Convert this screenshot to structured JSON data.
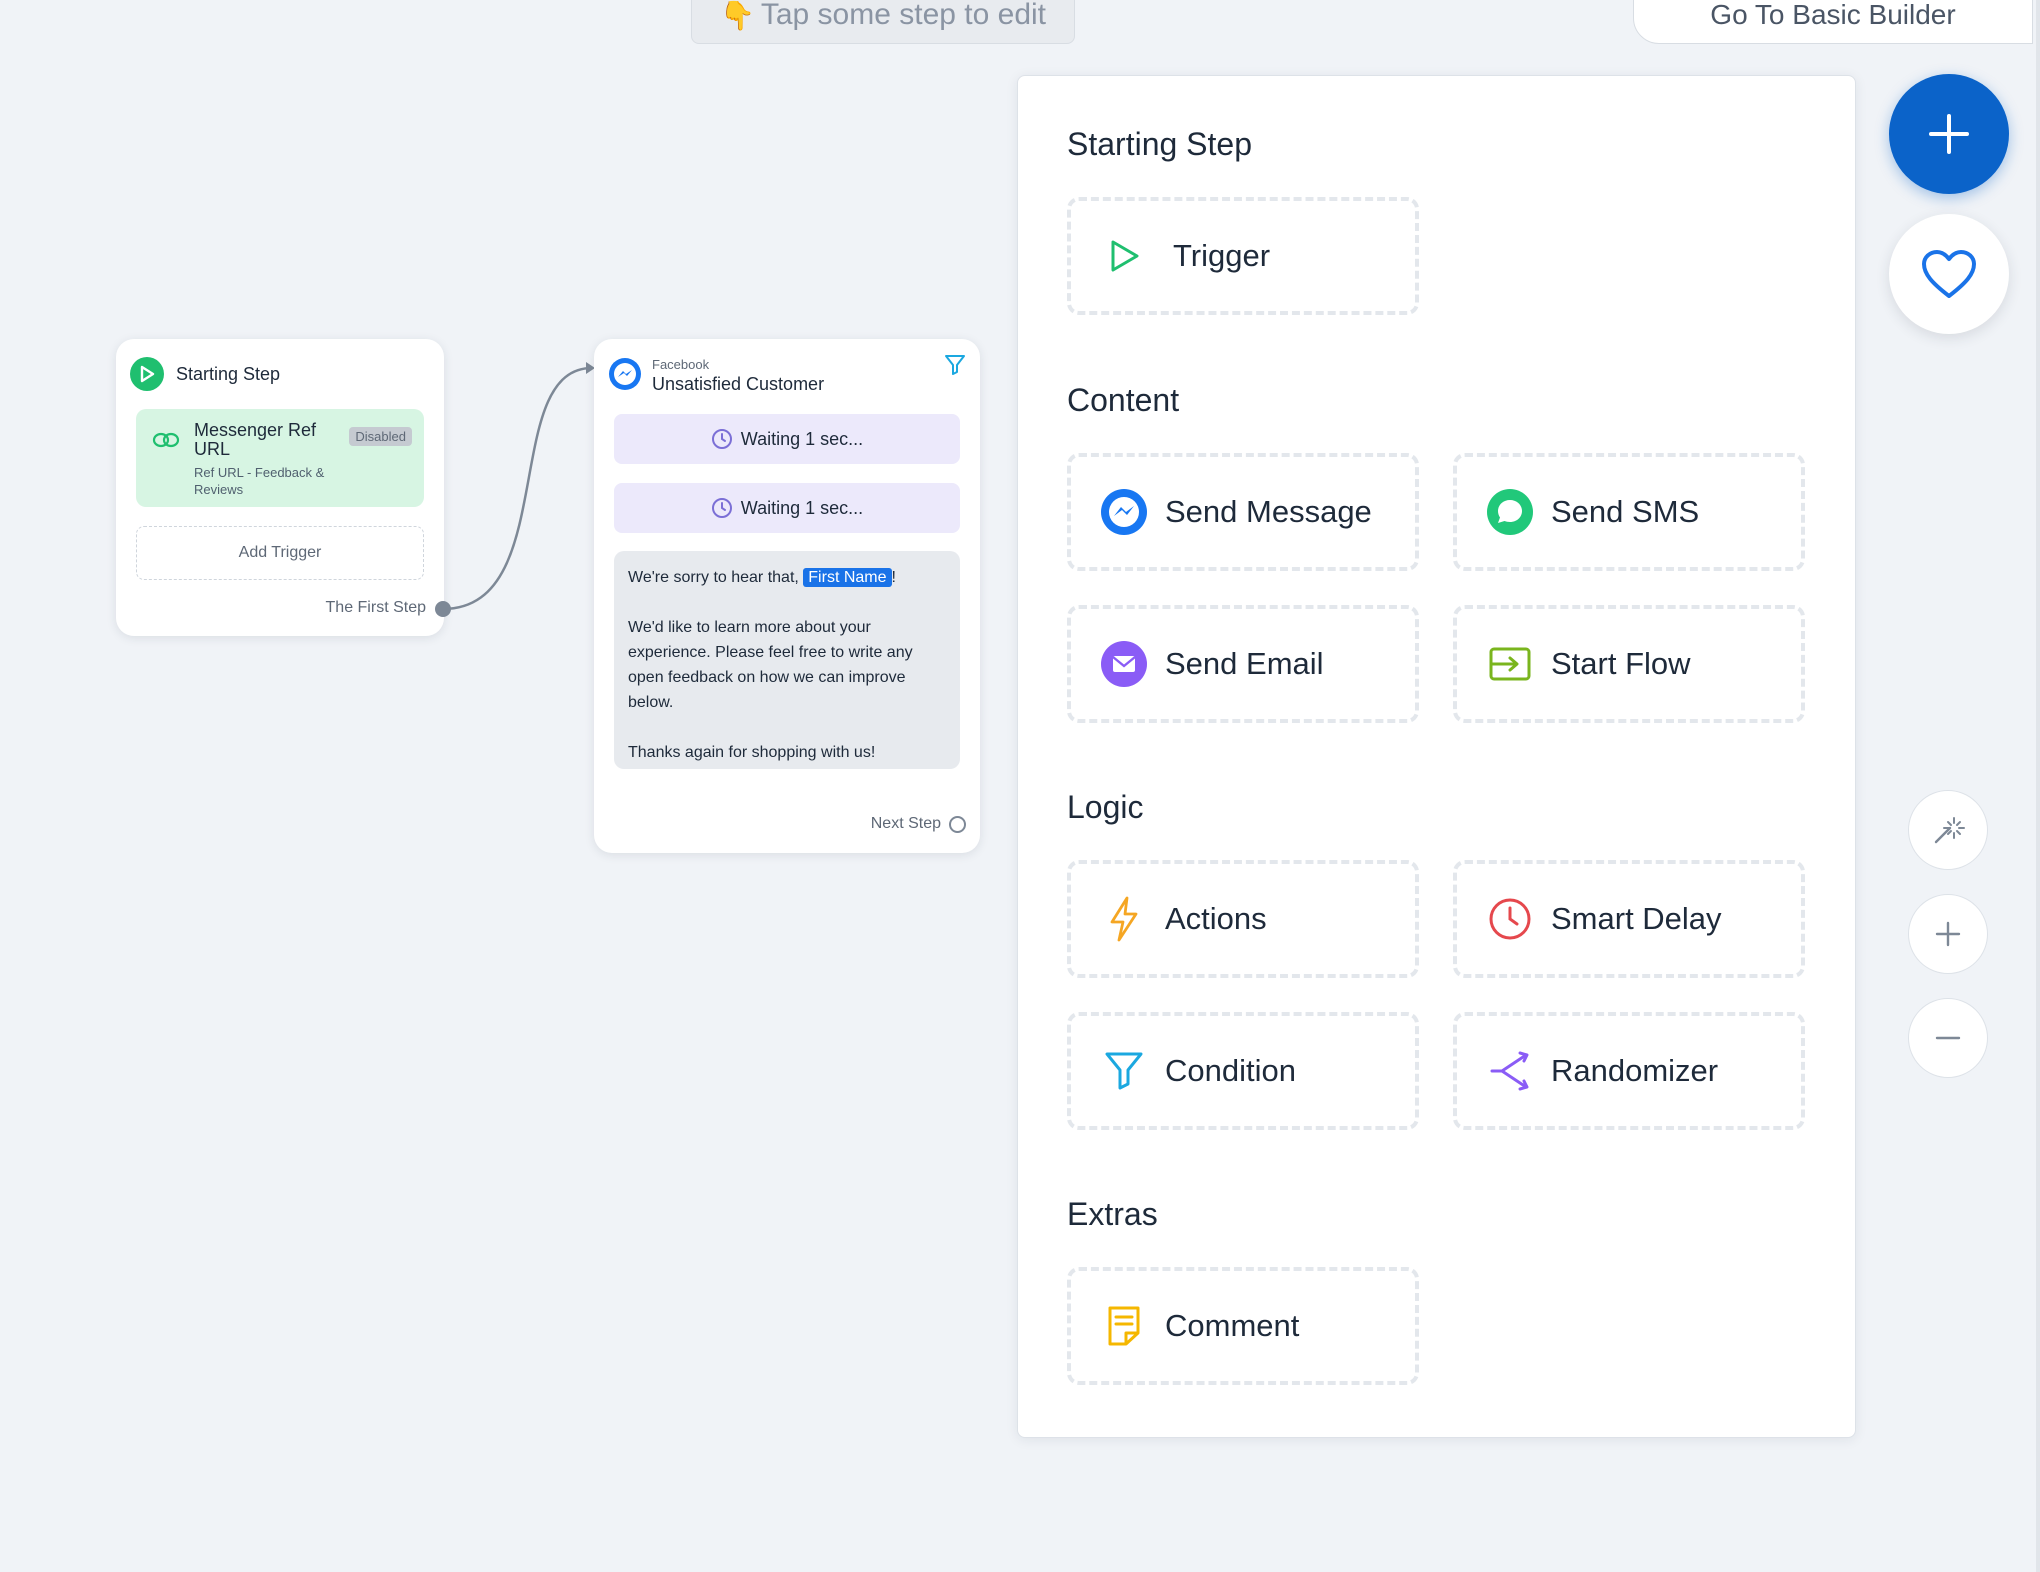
{
  "header": {
    "hint_icon": "pointing-hand-emoji",
    "hint_text": "Tap some step to edit",
    "basic_builder_label": "Go To Basic Builder"
  },
  "canvas": {
    "start_node": {
      "title": "Starting Step",
      "trigger": {
        "title": "Messenger Ref URL",
        "subtitle": "Ref URL - Feedback & Reviews",
        "badge": "Disabled"
      },
      "add_trigger_label": "Add Trigger",
      "output_label": "The First Step"
    },
    "message_node": {
      "platform": "Facebook",
      "title": "Unsatisfied Customer",
      "waits": [
        "Waiting 1 sec...",
        "Waiting 1 sec..."
      ],
      "message": {
        "greeting_before": "We're sorry to hear that, ",
        "variable": "First Name",
        "greeting_after": "!",
        "body": "We'd like to learn more about your experience. Please feel free to write any open feedback on how we can improve below.",
        "closing": "Thanks again for shopping with us!"
      },
      "output_label": "Next Step"
    }
  },
  "panel": {
    "sections": [
      {
        "title": "Starting Step",
        "items": [
          {
            "label": "Trigger",
            "icon": "play-icon"
          }
        ]
      },
      {
        "title": "Content",
        "items": [
          {
            "label": "Send Message",
            "icon": "messenger-icon"
          },
          {
            "label": "Send SMS",
            "icon": "sms-icon"
          },
          {
            "label": "Send Email",
            "icon": "email-icon"
          },
          {
            "label": "Start Flow",
            "icon": "start-flow-icon"
          }
        ]
      },
      {
        "title": "Logic",
        "items": [
          {
            "label": "Actions",
            "icon": "lightning-icon"
          },
          {
            "label": "Smart Delay",
            "icon": "clock-icon"
          },
          {
            "label": "Condition",
            "icon": "filter-icon"
          },
          {
            "label": "Randomizer",
            "icon": "randomizer-icon"
          }
        ]
      },
      {
        "title": "Extras",
        "items": [
          {
            "label": "Comment",
            "icon": "comment-icon"
          }
        ]
      }
    ]
  },
  "colors": {
    "primary": "#0b63c9",
    "green": "#1fbf6f",
    "messenger": "#1877f2",
    "email": "#8a5cf6",
    "start_flow": "#7ab51d",
    "actions": "#f5a623",
    "smart_delay": "#e5484d",
    "condition": "#1ba8e0",
    "randomizer": "#8a5cf6",
    "comment": "#f5b700"
  }
}
